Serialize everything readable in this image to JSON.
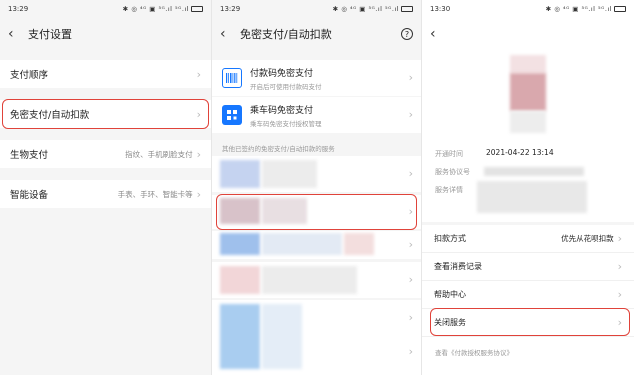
{
  "panel1": {
    "time": "13:29",
    "status_icons": "✱ ◎ ⁴ᴳ ▣ ⁵ᴳ.ıl ⁵ᴳ.ıl",
    "title": "支付设置",
    "rows": [
      {
        "label": "支付顺序",
        "value": ""
      },
      {
        "label": "免密支付/自动扣款",
        "value": ""
      },
      {
        "label": "生物支付",
        "value": "指纹、手机刷脸支付"
      },
      {
        "label": "智能设备",
        "value": "手表、手环、智能卡等"
      }
    ]
  },
  "panel2": {
    "time": "13:29",
    "status_icons": "✱ ◎ ⁴ᴳ ▣ ⁵ᴳ.ıl ⁵ᴳ.ıl",
    "title": "免密支付/自动扣款",
    "services": [
      {
        "title": "付款码免密支付",
        "subtitle": "开启后可使用付款码支付"
      },
      {
        "title": "乘车码免密支付",
        "subtitle": "乘车码免密支付授权管理"
      }
    ],
    "section_heading": "其他已签约的免密支付/自动扣款的服务"
  },
  "panel3": {
    "time": "13:30",
    "status_icons": "✱ ◎ ⁴ᴳ ▣ ⁵ᴳ.ıl ⁵ᴳ.ıl",
    "info": [
      {
        "label": "开通时间",
        "value": "2021-04-22 13:14"
      },
      {
        "label": "服务协议号",
        "value": ""
      },
      {
        "label": "服务详情",
        "value": ""
      }
    ],
    "rows": [
      {
        "label": "扣款方式",
        "value": "优先从花呗扣款"
      },
      {
        "label": "查看消费记录",
        "value": ""
      },
      {
        "label": "帮助中心",
        "value": ""
      },
      {
        "label": "关闭服务",
        "value": ""
      }
    ],
    "footnote": "查看《付款授权服务协议》"
  },
  "colors": {
    "highlight": "#e0433a",
    "background": "#f5f5f5",
    "icon_blue": "#1677ff"
  }
}
